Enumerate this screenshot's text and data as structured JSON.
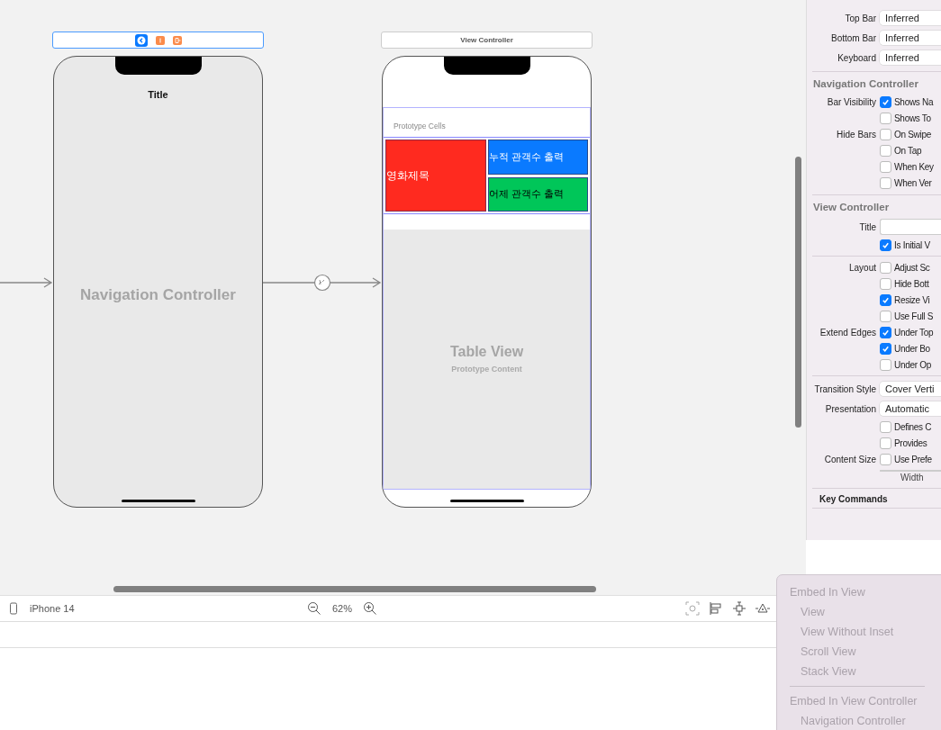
{
  "canvas": {
    "scenes": [
      {
        "kind": "navigation",
        "selected": true,
        "nav_title": "Title",
        "label": "Navigation Controller"
      },
      {
        "kind": "table",
        "selected": false,
        "dock_title": "View Controller",
        "section": "Prototype Cells",
        "cells": [
          {
            "text": "영화제목",
            "color": "#ff2a1f"
          },
          {
            "text": "누적 관객수 출력",
            "color": "#0a7aff"
          },
          {
            "text": "어제 관객수 출력",
            "color": "#00c659"
          }
        ],
        "label": "Table View",
        "sublabel": "Prototype Content"
      }
    ]
  },
  "toolbar": {
    "device": "iPhone 14",
    "zoom": "62%"
  },
  "inspector": {
    "rows": [
      {
        "kind": "popup",
        "label": "Top Bar",
        "value": "Inferred"
      },
      {
        "kind": "popup",
        "label": "Bottom Bar",
        "value": "Inferred"
      },
      {
        "kind": "popup",
        "label": "Keyboard",
        "value": "Inferred"
      },
      {
        "kind": "section",
        "title": "Navigation Controller"
      },
      {
        "kind": "check",
        "label": "Bar Visibility",
        "text": "Shows Na",
        "checked": true
      },
      {
        "kind": "check",
        "text": "Shows To",
        "checked": false
      },
      {
        "kind": "check",
        "label": "Hide Bars",
        "text": "On Swipe",
        "checked": false
      },
      {
        "kind": "check",
        "text": "On Tap",
        "checked": false
      },
      {
        "kind": "check",
        "text": "When Key",
        "checked": false
      },
      {
        "kind": "check",
        "text": "When Ver",
        "checked": false
      },
      {
        "kind": "section",
        "title": "View Controller"
      },
      {
        "kind": "field",
        "label": "Title"
      },
      {
        "kind": "check",
        "text": "Is Initial V",
        "checked": true
      },
      {
        "kind": "rule"
      },
      {
        "kind": "check",
        "label": "Layout",
        "text": "Adjust Sc",
        "checked": false
      },
      {
        "kind": "check",
        "text": "Hide Bott",
        "checked": false
      },
      {
        "kind": "check",
        "text": "Resize Vi",
        "checked": true
      },
      {
        "kind": "check",
        "text": "Use Full S",
        "checked": false
      },
      {
        "kind": "check",
        "label": "Extend Edges",
        "text": "Under Top",
        "checked": true
      },
      {
        "kind": "check",
        "text": "Under Bo",
        "checked": true
      },
      {
        "kind": "check",
        "text": "Under Op",
        "checked": false
      },
      {
        "kind": "rule"
      },
      {
        "kind": "popup",
        "label": "Transition Style",
        "value": "Cover Verti"
      },
      {
        "kind": "popup",
        "label": "Presentation",
        "value": "Automatic"
      },
      {
        "kind": "check",
        "text": "Defines C",
        "checked": false
      },
      {
        "kind": "check",
        "text": "Provides",
        "checked": false
      },
      {
        "kind": "check",
        "label": "Content Size",
        "text": "Use Prefe",
        "checked": false
      },
      {
        "kind": "width",
        "caption": "Width"
      },
      {
        "kind": "header",
        "title": "Key Commands"
      }
    ]
  },
  "menu": {
    "items": [
      {
        "kind": "header",
        "text": "Embed In View",
        "disabled": true
      },
      {
        "kind": "item",
        "text": "View",
        "disabled": true
      },
      {
        "kind": "item",
        "text": "View Without Inset",
        "disabled": true
      },
      {
        "kind": "item",
        "text": "Scroll View",
        "disabled": true
      },
      {
        "kind": "item",
        "text": "Stack View",
        "disabled": true
      },
      {
        "kind": "divider"
      },
      {
        "kind": "header",
        "text": "Embed In View Controller",
        "disabled": true
      },
      {
        "kind": "item",
        "text": "Navigation Controller",
        "disabled": true
      }
    ]
  }
}
